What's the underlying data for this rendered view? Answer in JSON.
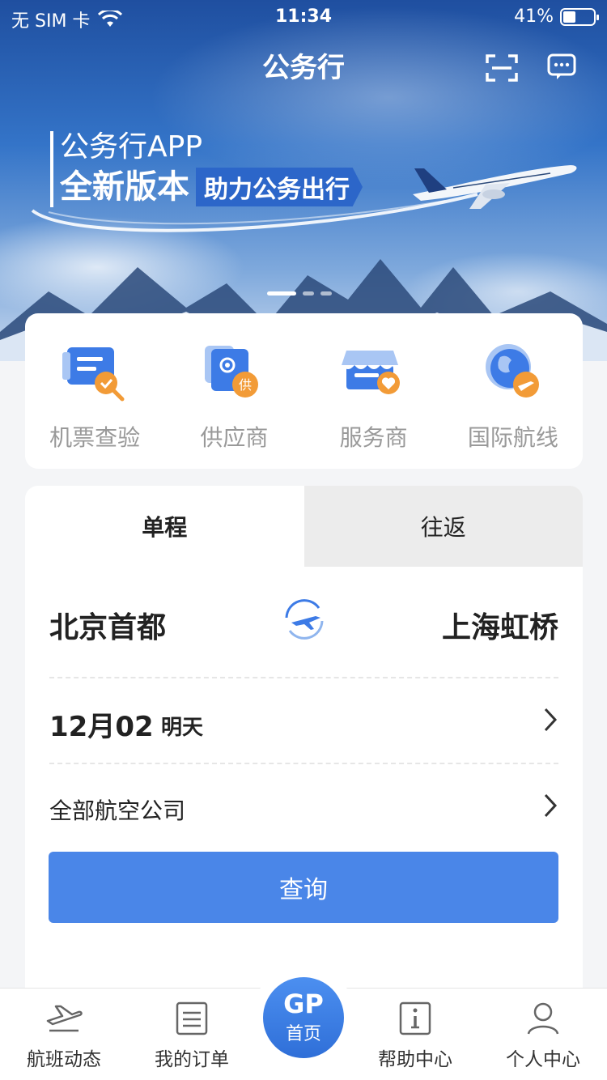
{
  "status_bar": {
    "carrier": "无 SIM 卡",
    "time": "11:34",
    "battery": "41%"
  },
  "header": {
    "title": "公务行"
  },
  "banner": {
    "subtitle": "公务行APP",
    "headline": "全新版本",
    "tag": "助力公务出行"
  },
  "quick_menu": [
    {
      "label": "机票查验",
      "icon": "ticket-check-icon"
    },
    {
      "label": "供应商",
      "icon": "supplier-icon"
    },
    {
      "label": "服务商",
      "icon": "service-store-icon"
    },
    {
      "label": "国际航线",
      "icon": "globe-plane-icon"
    }
  ],
  "search": {
    "tabs": [
      "单程",
      "往返"
    ],
    "active_tab": "单程",
    "from_city": "北京首都",
    "to_city": "上海虹桥",
    "date": "12月02",
    "date_note": "明天",
    "airline": "全部航空公司",
    "button": "查询"
  },
  "tabbar": {
    "items": [
      "航班动态",
      "我的订单",
      "首页",
      "帮助中心",
      "个人中心"
    ],
    "home_logo": "GP"
  },
  "colors": {
    "primary": "#4a86e8",
    "accent_orange": "#f29b37",
    "icon_blue": "#3d7be6"
  }
}
